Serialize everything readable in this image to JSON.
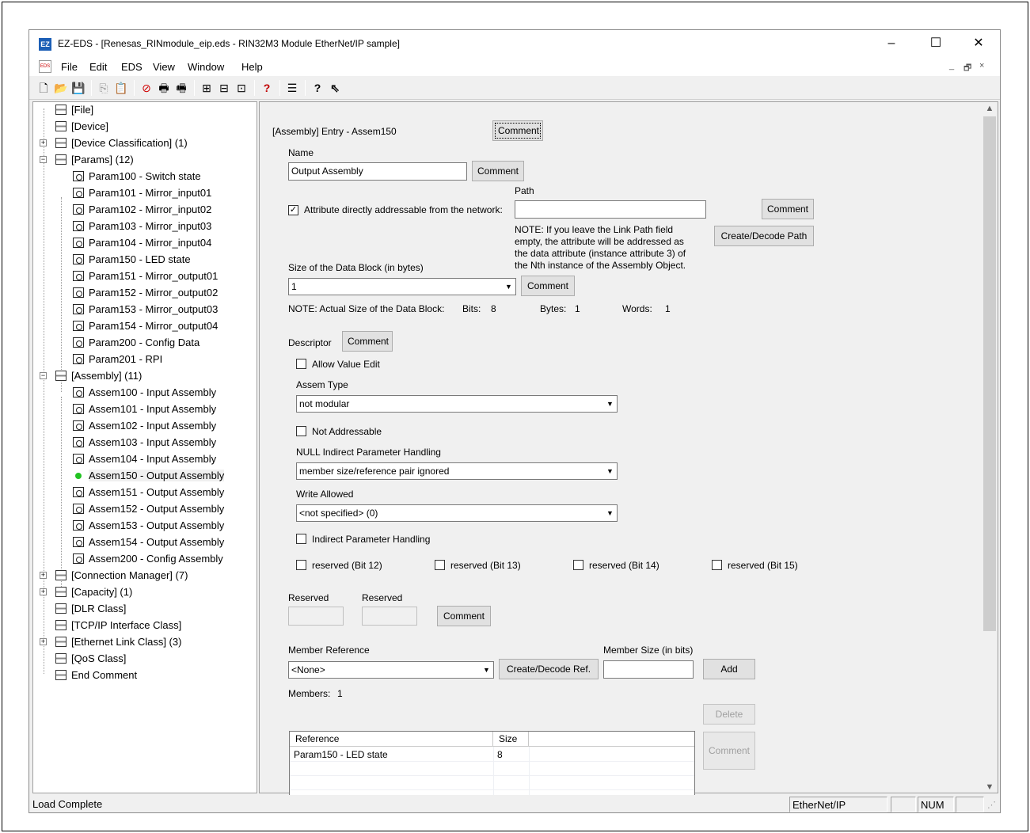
{
  "window": {
    "title": "EZ-EDS - [Renesas_RINmodule_eip.eds - RIN32M3 Module EtherNet/IP sample]",
    "app_icon": "EZ",
    "controls": {
      "minimize": "–",
      "maximize": "☐",
      "close": "✕"
    }
  },
  "menu": {
    "doc_icon": "EDS",
    "items": [
      "File",
      "Edit",
      "EDS",
      "View",
      "Window",
      "Help"
    ],
    "mdi_controls": [
      "_",
      "🗗",
      "×"
    ]
  },
  "toolbar": {
    "buttons": [
      {
        "name": "new-file-icon",
        "glyph": "🗋"
      },
      {
        "name": "open-folder-icon",
        "glyph": "📂"
      },
      {
        "name": "save-icon",
        "glyph": "💾"
      },
      {
        "name": "copy-icon",
        "glyph": "⎘"
      },
      {
        "name": "paste-icon",
        "glyph": "📋"
      },
      {
        "name": "stop-icon",
        "glyph": "⊘"
      },
      {
        "name": "print-icon",
        "glyph": "🖶"
      },
      {
        "name": "print-preview-icon",
        "glyph": "🖷"
      },
      {
        "name": "tree-icon",
        "glyph": "⊞"
      },
      {
        "name": "module-icon",
        "glyph": "⊟"
      },
      {
        "name": "vendor-icon",
        "glyph": "⊡"
      },
      {
        "name": "help-book-icon",
        "glyph": "?"
      },
      {
        "name": "text-view-icon",
        "glyph": "☰"
      },
      {
        "name": "help-icon",
        "glyph": "?"
      },
      {
        "name": "context-help-icon",
        "glyph": "⇖"
      }
    ]
  },
  "tree": {
    "items": [
      {
        "label": "[File]",
        "level": 0,
        "icon": "folder",
        "expander": ""
      },
      {
        "label": "[Device]",
        "level": 0,
        "icon": "folder",
        "expander": ""
      },
      {
        "label": "[Device Classification] (1)",
        "level": 0,
        "icon": "folder",
        "expander": "+"
      },
      {
        "label": "[Params] (12)",
        "level": 0,
        "icon": "folder",
        "expander": "−"
      },
      {
        "label": "Param100 - Switch state",
        "level": 1,
        "icon": "param"
      },
      {
        "label": "Param101 - Mirror_input01",
        "level": 1,
        "icon": "param"
      },
      {
        "label": "Param102 - Mirror_input02",
        "level": 1,
        "icon": "param"
      },
      {
        "label": "Param103 - Mirror_input03",
        "level": 1,
        "icon": "param"
      },
      {
        "label": "Param104 - Mirror_input04",
        "level": 1,
        "icon": "param"
      },
      {
        "label": "Param150 - LED state",
        "level": 1,
        "icon": "param"
      },
      {
        "label": "Param151 - Mirror_output01",
        "level": 1,
        "icon": "param"
      },
      {
        "label": "Param152 - Mirror_output02",
        "level": 1,
        "icon": "param"
      },
      {
        "label": "Param153 - Mirror_output03",
        "level": 1,
        "icon": "param"
      },
      {
        "label": "Param154 - Mirror_output04",
        "level": 1,
        "icon": "param"
      },
      {
        "label": "Param200 - Config Data",
        "level": 1,
        "icon": "param"
      },
      {
        "label": "Param201 - RPI",
        "level": 1,
        "icon": "param"
      },
      {
        "label": "[Assembly] (11)",
        "level": 0,
        "icon": "folder",
        "expander": "−"
      },
      {
        "label": "Assem100 - Input Assembly",
        "level": 1,
        "icon": "param"
      },
      {
        "label": "Assem101 - Input Assembly",
        "level": 1,
        "icon": "param"
      },
      {
        "label": "Assem102 - Input Assembly",
        "level": 1,
        "icon": "param"
      },
      {
        "label": "Assem103 - Input Assembly",
        "level": 1,
        "icon": "param"
      },
      {
        "label": "Assem104 - Input Assembly",
        "level": 1,
        "icon": "param"
      },
      {
        "label": "Assem150 - Output Assembly",
        "level": 1,
        "icon": "active",
        "selected": true
      },
      {
        "label": "Assem151 - Output Assembly",
        "level": 1,
        "icon": "param"
      },
      {
        "label": "Assem152 - Output Assembly",
        "level": 1,
        "icon": "param"
      },
      {
        "label": "Assem153 - Output Assembly",
        "level": 1,
        "icon": "param"
      },
      {
        "label": "Assem154 - Output Assembly",
        "level": 1,
        "icon": "param"
      },
      {
        "label": "Assem200 - Config Assembly",
        "level": 1,
        "icon": "param"
      },
      {
        "label": "[Connection Manager] (7)",
        "level": 0,
        "icon": "folder",
        "expander": "+"
      },
      {
        "label": "[Capacity] (1)",
        "level": 0,
        "icon": "folder",
        "expander": "+"
      },
      {
        "label": "[DLR Class]",
        "level": 0,
        "icon": "folder",
        "expander": ""
      },
      {
        "label": "[TCP/IP Interface Class]",
        "level": 0,
        "icon": "folder",
        "expander": ""
      },
      {
        "label": "[Ethernet Link Class] (3)",
        "level": 0,
        "icon": "folder",
        "expander": "+"
      },
      {
        "label": "[QoS Class]",
        "level": 0,
        "icon": "folder",
        "expander": ""
      },
      {
        "label": "End Comment",
        "level": 0,
        "icon": "folder",
        "expander": ""
      }
    ]
  },
  "form": {
    "entry_label": "[Assembly] Entry - Assem150",
    "comment_label": "Comment",
    "name_label": "Name",
    "name_value": "Output Assembly",
    "addressable_label": "Attribute directly addressable from the network:",
    "addressable_checked": "✓",
    "path_label": "Path",
    "path_value": "",
    "path_note": "NOTE: If you leave the Link Path field empty, the attribute will be addressed as the data attribute (instance attribute 3) of the Nth instance of the Assembly Object.",
    "create_decode_path_label": "Create/Decode Path",
    "size_label": "Size of the Data Block (in bytes)",
    "size_value": "1",
    "size_note": "NOTE: Actual Size of the Data Block:",
    "bits_label": "Bits:",
    "bits_value": "8",
    "bytes_label": "Bytes:",
    "bytes_value": "1",
    "words_label": "Words:",
    "words_value": "1",
    "descriptor_label": "Descriptor",
    "allow_value_edit_label": "Allow Value Edit",
    "assem_type_label": "Assem Type",
    "assem_type_value": "not modular",
    "not_addressable_label": "Not Addressable",
    "null_indirect_label": "NULL Indirect Parameter Handling",
    "null_indirect_value": "member size/reference pair ignored",
    "write_allowed_label": "Write Allowed",
    "write_allowed_value": "<not specified> (0)",
    "indirect_param_label": "Indirect Parameter Handling",
    "reserved_bits": [
      "reserved (Bit 12)",
      "reserved (Bit 13)",
      "reserved (Bit 14)",
      "reserved (Bit 15)"
    ],
    "reserved_label_1": "Reserved",
    "reserved_label_2": "Reserved",
    "member_reference_label": "Member Reference",
    "member_reference_value": "<None>",
    "create_decode_ref_label": "Create/Decode Ref.",
    "member_size_label": "Member Size (in bits)",
    "member_size_value": "",
    "add_label": "Add",
    "members_label": "Members:",
    "members_count": "1",
    "delete_label": "Delete",
    "table_headers": {
      "reference": "Reference",
      "size": "Size"
    },
    "members": [
      {
        "reference": "Param150 - LED state",
        "size": "8"
      }
    ]
  },
  "status": {
    "message": "Load Complete",
    "protocol": "EtherNet/IP",
    "num": "NUM"
  }
}
